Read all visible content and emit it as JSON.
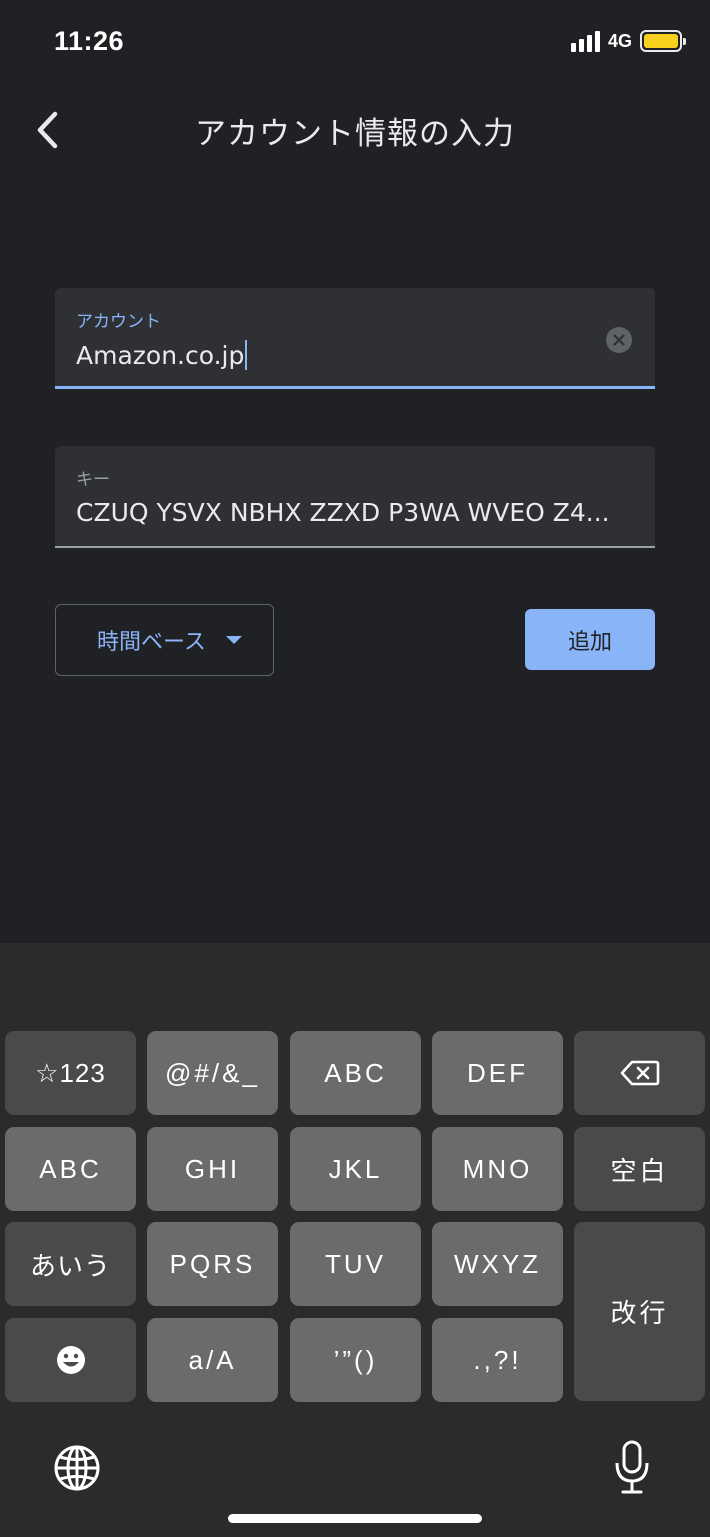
{
  "status_bar": {
    "time": "11:26",
    "network": "4G"
  },
  "header": {
    "title": "アカウント情報の入力"
  },
  "form": {
    "account": {
      "label": "アカウント",
      "value": "Amazon.co.jp"
    },
    "key": {
      "label": "キー",
      "value": "CZUQ YSVX NBHX ZZXD P3WA WVEO Z4..."
    },
    "type_select": {
      "selected": "時間ベース"
    },
    "add_button": "追加"
  },
  "keyboard": {
    "row1": [
      "☆123",
      "@#/&_",
      "ABC",
      "DEF"
    ],
    "row2": [
      "ABC",
      "GHI",
      "JKL",
      "MNO",
      "空白"
    ],
    "row3": [
      "あいう",
      "PQRS",
      "TUV",
      "WXYZ"
    ],
    "row4": [
      "a/A",
      "’”()",
      ".,?!"
    ],
    "return": "改行"
  },
  "colors": {
    "background": "#202124",
    "accent": "#8ab4f8",
    "field_bg": "#2e3034",
    "battery": "#f7d11e"
  }
}
